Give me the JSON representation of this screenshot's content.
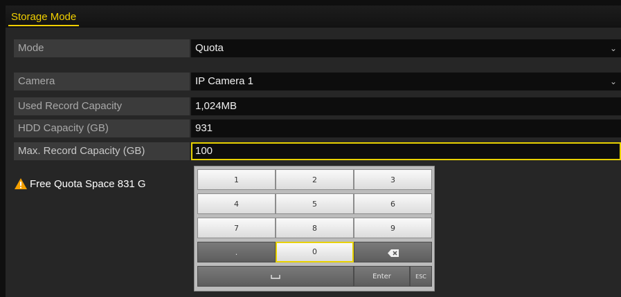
{
  "header": {
    "tab_label": "Storage Mode"
  },
  "form": {
    "mode": {
      "label": "Mode",
      "value": "Quota"
    },
    "camera": {
      "label": "Camera",
      "value": "IP Camera 1"
    },
    "used": {
      "label": "Used Record Capacity",
      "value": "1,024MB"
    },
    "hdd": {
      "label": "HDD Capacity (GB)",
      "value": "931"
    },
    "max": {
      "label": "Max. Record Capacity (GB)",
      "value": "100"
    }
  },
  "warning": {
    "text": "Free Quota Space 831 G",
    "icon": "warning-triangle-icon"
  },
  "keypad": {
    "keys": [
      "1",
      "2",
      "3",
      "4",
      "5",
      "6",
      "7",
      "8",
      "9",
      ".",
      "0"
    ],
    "backspace_icon": "backspace-icon",
    "space_icon": "space-bar-icon",
    "enter_label": "Enter",
    "esc_label": "ESC",
    "selected_key": "0"
  },
  "colors": {
    "accent": "#e8d200",
    "warning": "#f5a000"
  }
}
